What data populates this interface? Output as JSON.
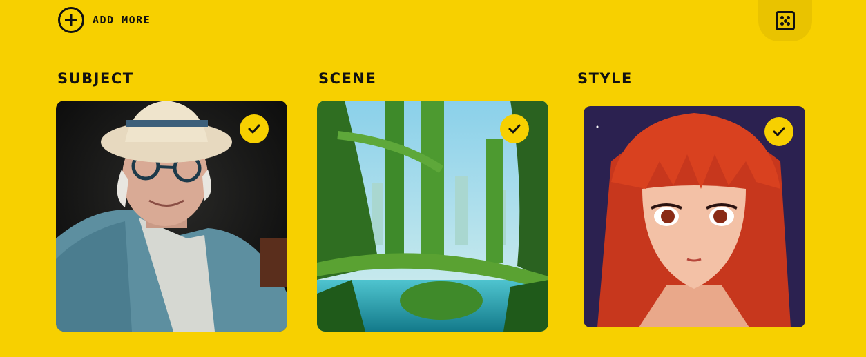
{
  "toolbar": {
    "add_more_label": "ADD MORE",
    "dice_icon": "dice-icon"
  },
  "columns": [
    {
      "title": "SUBJECT",
      "selected": true,
      "image": "elderly-man-in-hat-and-blue-jacket"
    },
    {
      "title": "SCENE",
      "selected": true,
      "image": "overgrown-green-city-towers-and-bridges"
    },
    {
      "title": "STYLE",
      "selected": true,
      "image": "anime-girl-with-red-hair"
    }
  ],
  "colors": {
    "background": "#f7d000",
    "accent": "#f7d000",
    "text": "#111111"
  }
}
